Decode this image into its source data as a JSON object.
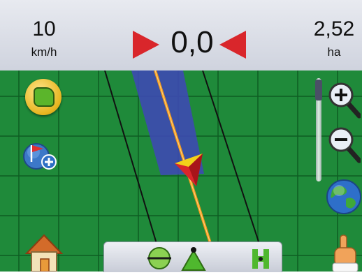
{
  "status_bar": {
    "speed": {
      "value": "10",
      "unit": "km/h"
    },
    "cross_track": {
      "value": "0,0"
    },
    "area": {
      "value": "2,52",
      "unit": "ha"
    }
  },
  "colors": {
    "field": "#1f8a3a",
    "grid": "#0e5d22",
    "swath": "#3d49b3",
    "guideline": "#f39a1c",
    "arrow": "#d9262b"
  },
  "left_buttons": [
    "boundary-icon",
    "marker-flag-icon",
    "home-icon"
  ],
  "right_buttons": [
    "zoom-in-icon",
    "zoom-out-icon",
    "globe-view-icon",
    "pan-hand-icon"
  ],
  "toolbar_items": [
    "straight-ab-line-icon",
    "pivot-icon",
    "ab-line-select-icon"
  ]
}
